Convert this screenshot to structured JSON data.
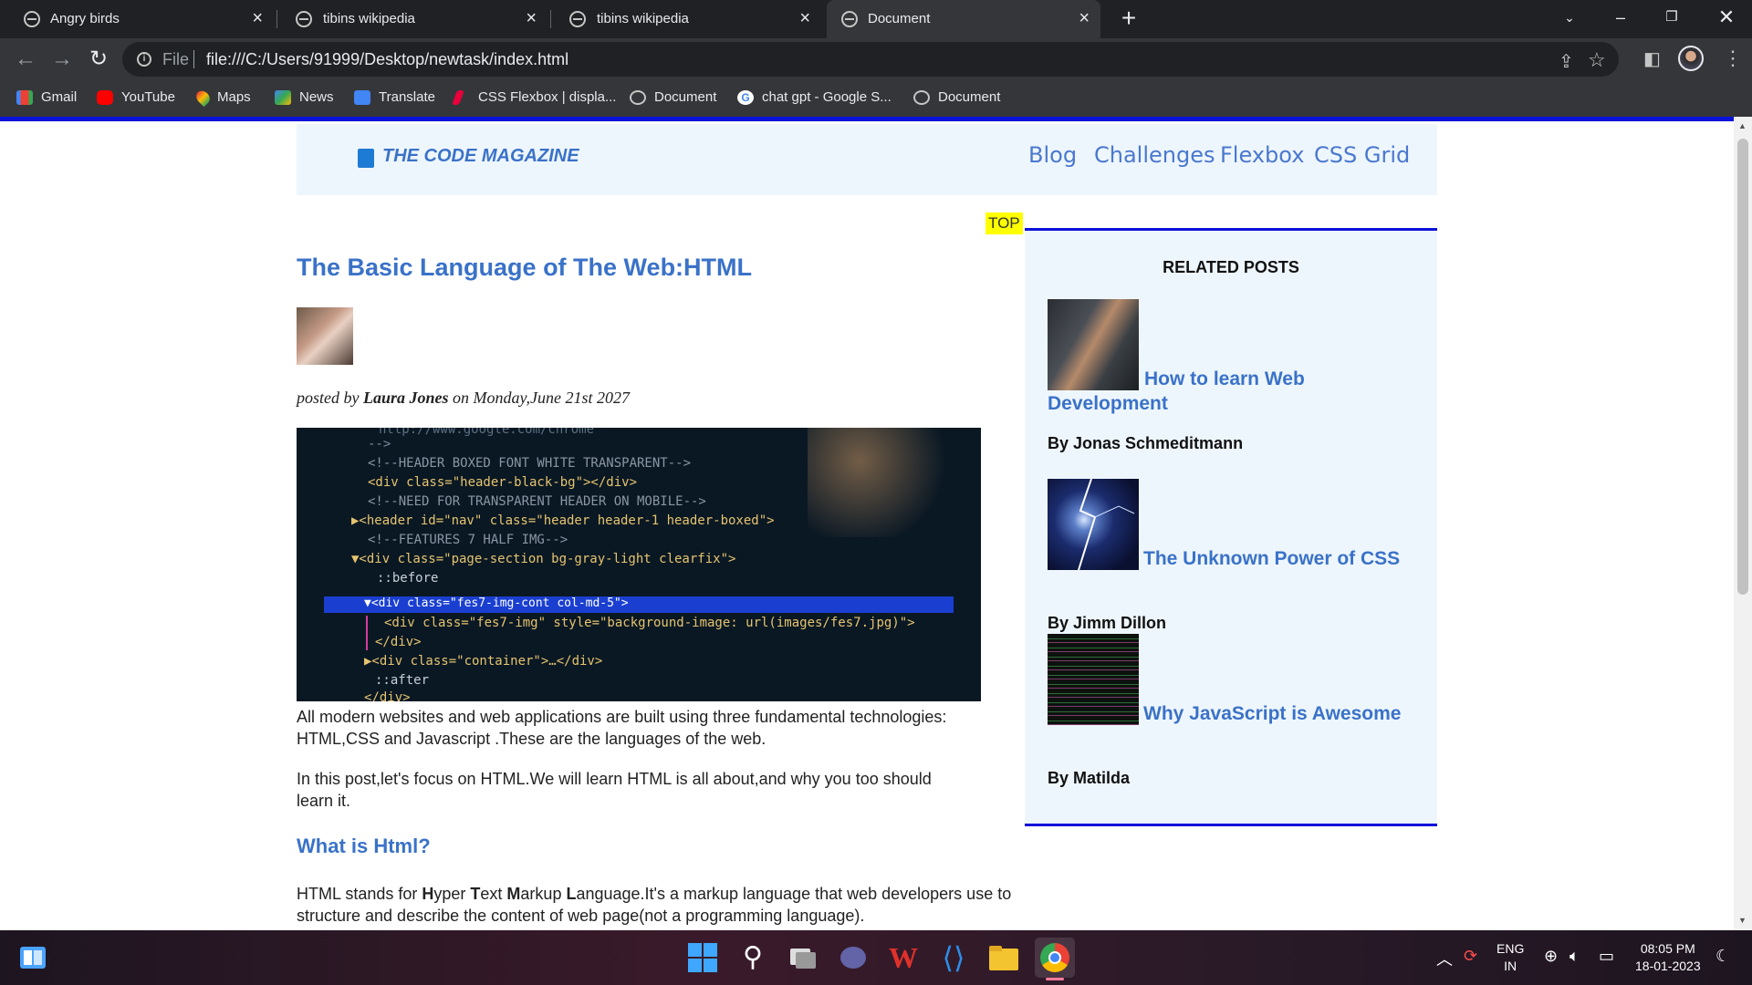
{
  "browser": {
    "tabs": [
      {
        "title": "Angry birds",
        "active": false
      },
      {
        "title": "tibins wikipedia",
        "active": false
      },
      {
        "title": "tibins wikipedia",
        "active": false
      },
      {
        "title": "Document",
        "active": true
      }
    ],
    "url_scheme": "File",
    "url": "file:///C:/Users/91999/Desktop/newtask/index.html",
    "bookmarks": [
      {
        "label": "Gmail",
        "color": "#ea4335"
      },
      {
        "label": "YouTube",
        "color": "#ff0000"
      },
      {
        "label": "Maps",
        "color": "#34a853"
      },
      {
        "label": "News",
        "color": "#4285f4"
      },
      {
        "label": "Translate",
        "color": "#4285f4"
      },
      {
        "label": "CSS Flexbox | displa...",
        "color": "#e8003c"
      },
      {
        "label": "Document",
        "color": "#9aa0a6"
      },
      {
        "label": "chat gpt - Google S...",
        "color": "#ffffff"
      },
      {
        "label": "Document",
        "color": "#9aa0a6"
      }
    ]
  },
  "site": {
    "brand": "THE CODE MAGAZINE",
    "nav": [
      "Blog",
      "Challenges",
      "Flexbox",
      "CSS Grid"
    ],
    "top_badge": "TOP"
  },
  "article": {
    "title": "The Basic Language of The Web:HTML",
    "byline_prefix": "posted by ",
    "author": "Laura Jones",
    "byline_suffix": " on Monday,June 21st 2027",
    "code_lines": [
      "  http://www.google.com/chrome",
      "-->",
      "<!--HEADER BOXED FONT WHITE TRANSPARENT-->",
      "<div class=\"header-black-bg\"></div>",
      "<!--NEED FOR TRANSPARENT HEADER ON MOBILE-->",
      "▶<header id=\"nav\" class=\"header header-1 header-boxed\">",
      "<!--FEATURES 7 HALF IMG-->",
      "▼<div class=\"page-section bg-gray-light clearfix\">",
      "  ::before",
      "▼<div class=\"fes7-img-cont col-md-5\">",
      "  <div class=\"fes7-img\" style=\"background-image: url(images/fes7.jpg)\">",
      "  </div>",
      "▶<div class=\"container\">…</div>",
      "  ::after",
      "</div>"
    ],
    "para1": "All modern websites and web applications are built using three fundamental technologies: HTML,CSS and Javascript .These are the languages of the web.",
    "para2": "In this post,let's focus on HTML.We will learn HTML is all about,and why you too should learn it.",
    "subheading": "What is Html?",
    "para3_parts": [
      "HTML stands for ",
      "H",
      "yper ",
      "T",
      "ext ",
      "M",
      "arkup ",
      "L",
      "anguage.It's a markup language that web developers use to structure and describe the content of web page(not a programming language)."
    ]
  },
  "sidebar": {
    "title": "RELATED POSTS",
    "posts": [
      {
        "title": "How to learn Web Development",
        "author": "By Jonas Schmeditmann"
      },
      {
        "title": "The Unknown Power of CSS",
        "author": "By Jimm Dillon"
      },
      {
        "title": "Why JavaScript is Awesome",
        "author": "By Matilda"
      }
    ]
  },
  "taskbar": {
    "lang": "ENG",
    "region": "IN",
    "time": "08:05 PM",
    "date": "18-01-2023"
  }
}
